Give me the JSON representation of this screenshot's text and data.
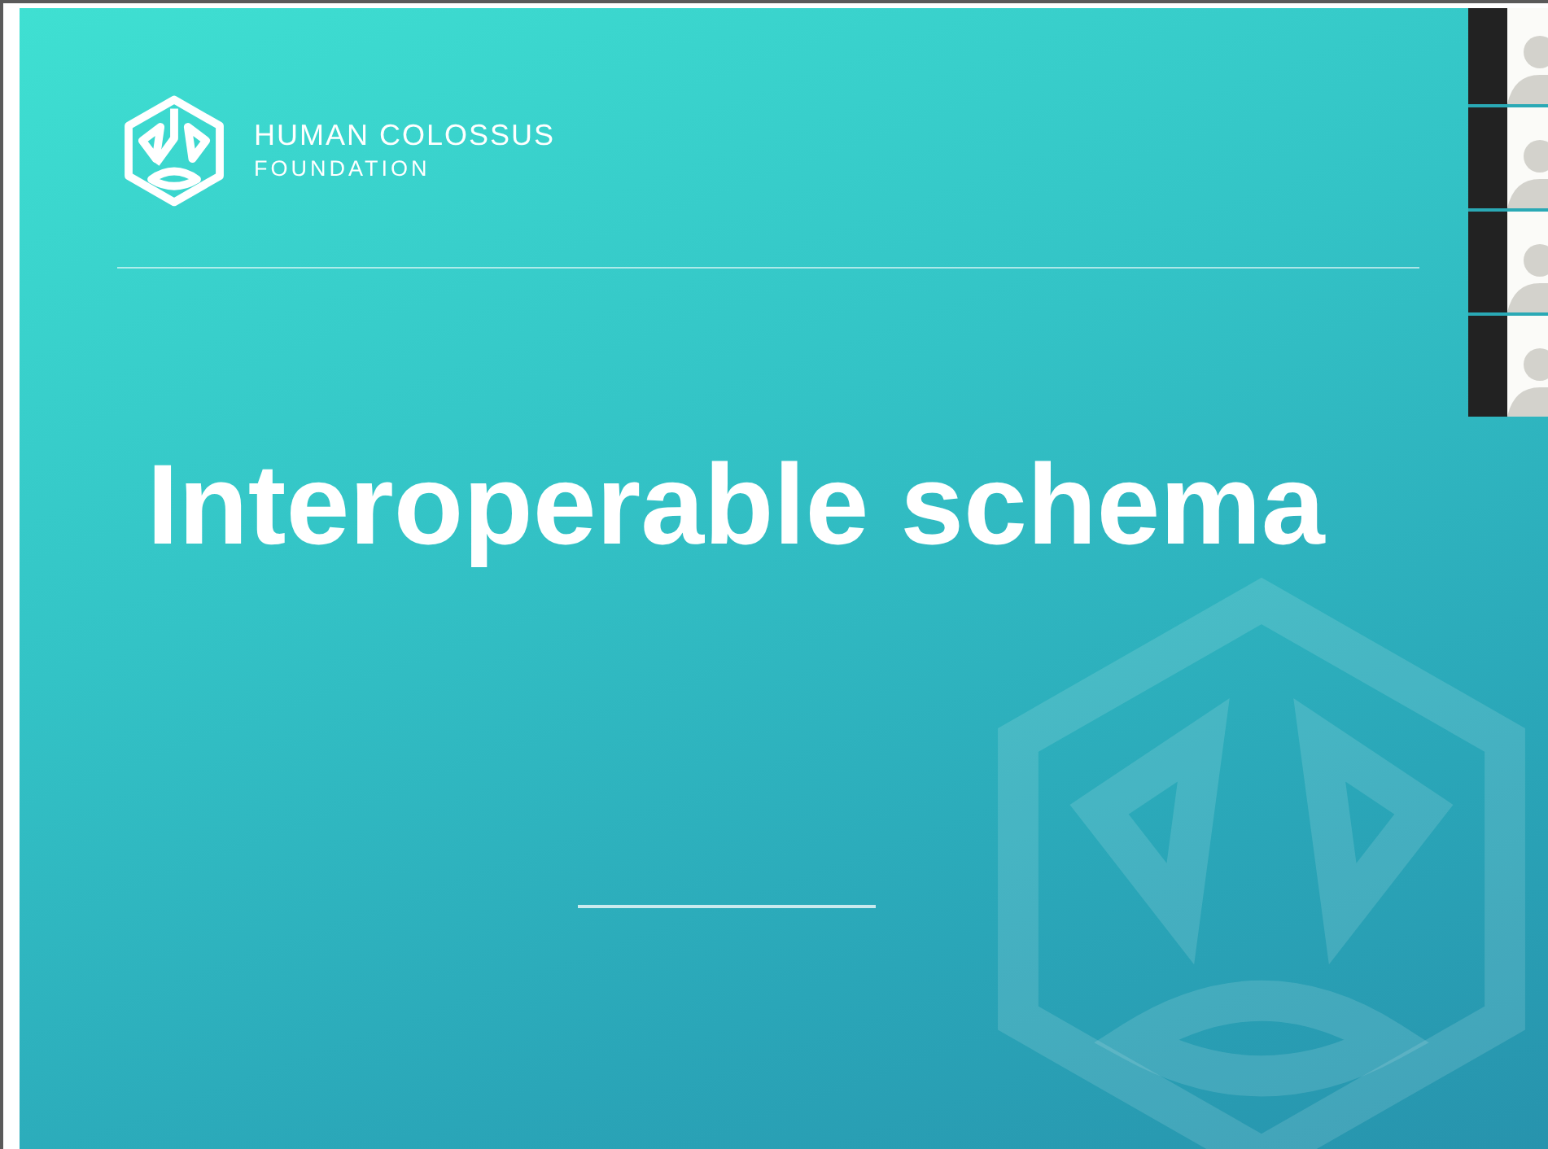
{
  "slide": {
    "org_name": "HUMAN COLOSSUS",
    "org_subtitle": "FOUNDATION",
    "title": "Interoperable schema"
  }
}
